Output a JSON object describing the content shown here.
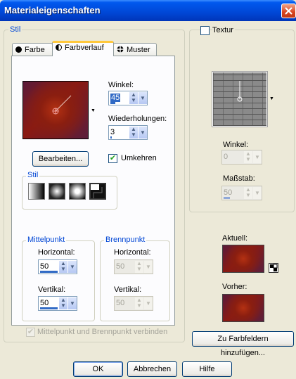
{
  "window": {
    "title": "Materialeigenschaften"
  },
  "stil_group": {
    "label": "Stil"
  },
  "tabs": [
    {
      "label": "Farbe",
      "icon": "filled-circle-icon"
    },
    {
      "label": "Farbverlauf",
      "icon": "half-circle-icon"
    },
    {
      "label": "Muster",
      "icon": "crosshair-pattern-icon"
    }
  ],
  "gradient": {
    "winkel_label": "Winkel:",
    "winkel_value": "45",
    "wiederholungen_label": "Wiederholungen:",
    "wiederholungen_value": "3",
    "edit_button": "Bearbeiten...",
    "invert_label": "Umkehren",
    "invert_checked": true,
    "style_label": "Stil",
    "style_buttons": [
      "linear-style-icon",
      "rectangular-style-icon",
      "sunburst-style-icon",
      "radial-style-icon"
    ]
  },
  "mittelpunkt": {
    "label": "Mittelpunkt",
    "horizontal_label": "Horizontal:",
    "horizontal_value": "50",
    "vertikal_label": "Vertikal:",
    "vertikal_value": "50"
  },
  "brennpunkt": {
    "label": "Brennpunkt",
    "horizontal_label": "Horizontal:",
    "horizontal_value": "50",
    "vertikal_label": "Vertikal:",
    "vertikal_value": "50"
  },
  "link_checkbox": {
    "label": "Mittelpunkt und Brennpunkt verbinden",
    "checked": true,
    "enabled": false
  },
  "textur": {
    "label": "Textur",
    "checked": false,
    "winkel_label": "Winkel:",
    "winkel_value": "0",
    "masstab_label": "Maßstab:",
    "masstab_value": "50"
  },
  "preview": {
    "aktuell_label": "Aktuell:",
    "vorher_label": "Vorher:",
    "add_swatch_button": "Zu Farbfeldern hinzufügen..."
  },
  "footer": {
    "ok": "OK",
    "cancel": "Abbrechen",
    "help": "Hilfe"
  },
  "colors": {
    "title_bar": "#0054e3",
    "gradient_dark": "#5a1a3a",
    "gradient_red": "#b43112",
    "group_label": "#0046d5"
  }
}
